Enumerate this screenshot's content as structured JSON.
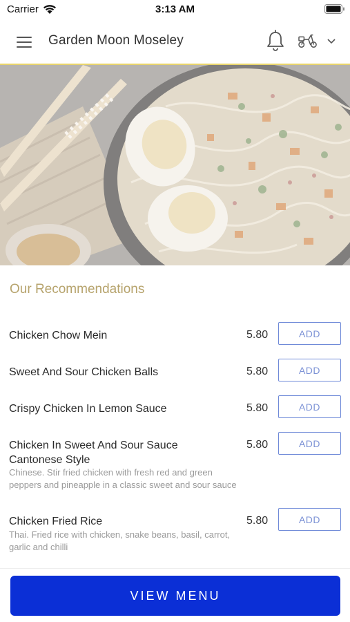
{
  "status_bar": {
    "carrier": "Carrier",
    "time": "3:13 AM"
  },
  "header": {
    "title": "Garden Moon Moseley",
    "icons": [
      "hamburger-menu-icon",
      "bell-icon",
      "delivery-scooter-icon",
      "chevron-down-icon"
    ]
  },
  "hero": {
    "image": "noodle-bowl-photo"
  },
  "recommendations": {
    "title": "Our Recommendations",
    "items": [
      {
        "name": "Chicken Chow Mein",
        "description": "",
        "price": "5.80",
        "add_label": "ADD"
      },
      {
        "name": "Sweet And Sour Chicken Balls",
        "description": "",
        "price": "5.80",
        "add_label": "ADD"
      },
      {
        "name": "Crispy Chicken In Lemon Sauce",
        "description": "",
        "price": "5.80",
        "add_label": "ADD"
      },
      {
        "name": "Chicken In Sweet And Sour Sauce Cantonese Style",
        "description": "Chinese. Stir fried chicken with fresh red and green peppers and pineapple in a classic sweet and sour sauce",
        "price": "5.80",
        "add_label": "ADD"
      },
      {
        "name": "Chicken Fried Rice",
        "description": "Thai. Fried rice with chicken, snake beans, basil, carrot, garlic and chilli",
        "price": "5.80",
        "add_label": "ADD"
      }
    ]
  },
  "footer": {
    "view_menu_label": "VIEW MENU"
  },
  "colors": {
    "header_underline": "#e8d46b",
    "section_title": "#b6a36c",
    "add_button_border": "#6f8ad8",
    "view_menu_button": "#0b2fd6"
  }
}
